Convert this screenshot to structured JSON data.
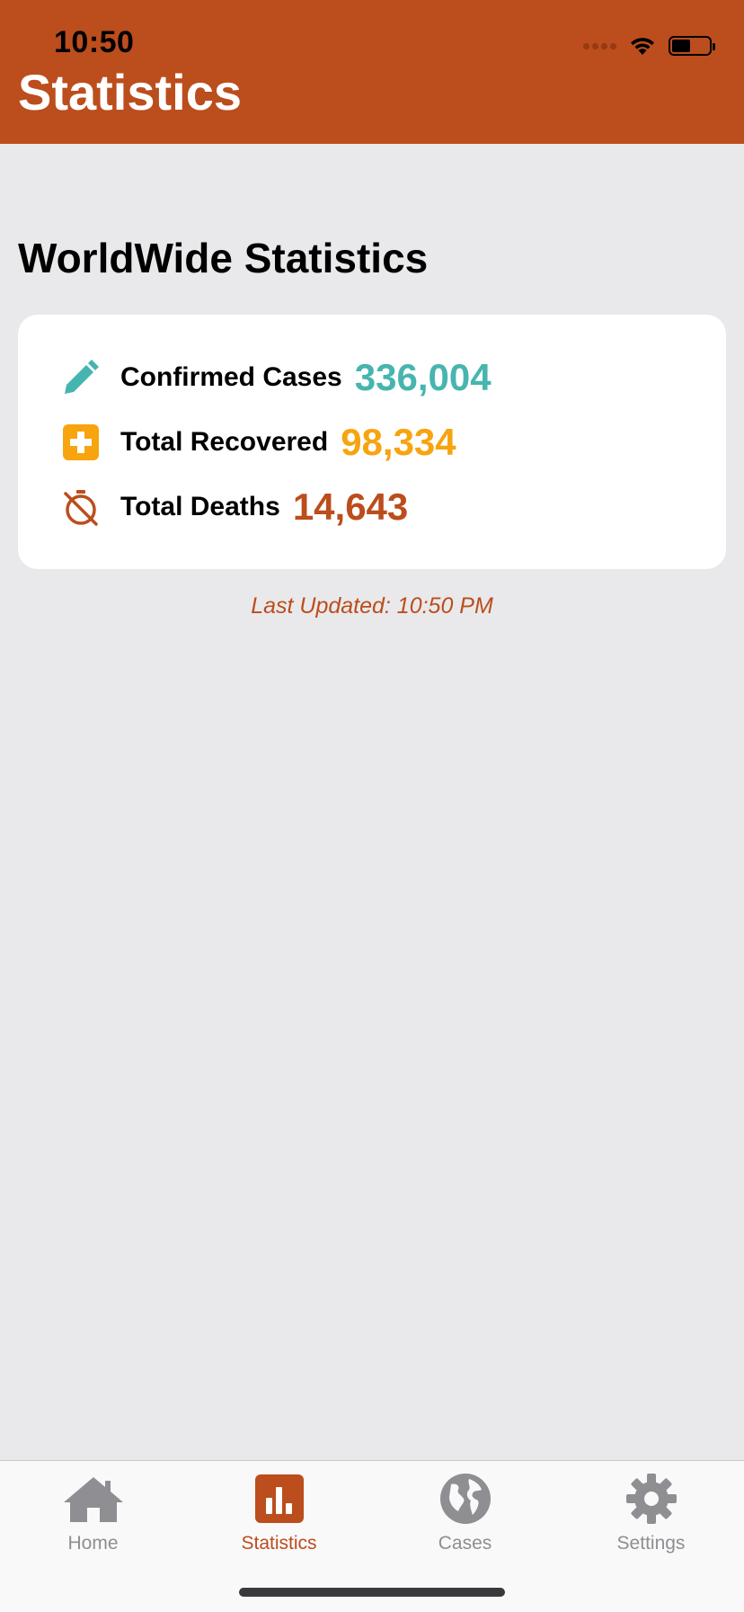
{
  "status_bar": {
    "time": "10:50",
    "battery_percent": 50
  },
  "header": {
    "title": "Statistics",
    "color": "#bc4d1c"
  },
  "section": {
    "title": "WorldWide Statistics"
  },
  "stats": [
    {
      "label": "Confirmed Cases",
      "value": "336,004",
      "color": "#46b5af",
      "icon": "pencil-icon"
    },
    {
      "label": "Total Recovered",
      "value": "98,334",
      "color": "#f7a40f",
      "icon": "medical-cross-icon"
    },
    {
      "label": "Total Deaths",
      "value": "14,643",
      "color": "#bc4d1c",
      "icon": "stopwatch-off-icon"
    }
  ],
  "last_updated": "Last Updated: 10:50 PM",
  "tabbar": {
    "items": [
      {
        "label": "Home",
        "icon": "house-icon",
        "active": false
      },
      {
        "label": "Statistics",
        "icon": "bar-chart-icon",
        "active": true
      },
      {
        "label": "Cases",
        "icon": "globe-icon",
        "active": false
      },
      {
        "label": "Settings",
        "icon": "gear-icon",
        "active": false
      }
    ],
    "active_color": "#bc4d1c",
    "inactive_color": "#8e8e93"
  }
}
